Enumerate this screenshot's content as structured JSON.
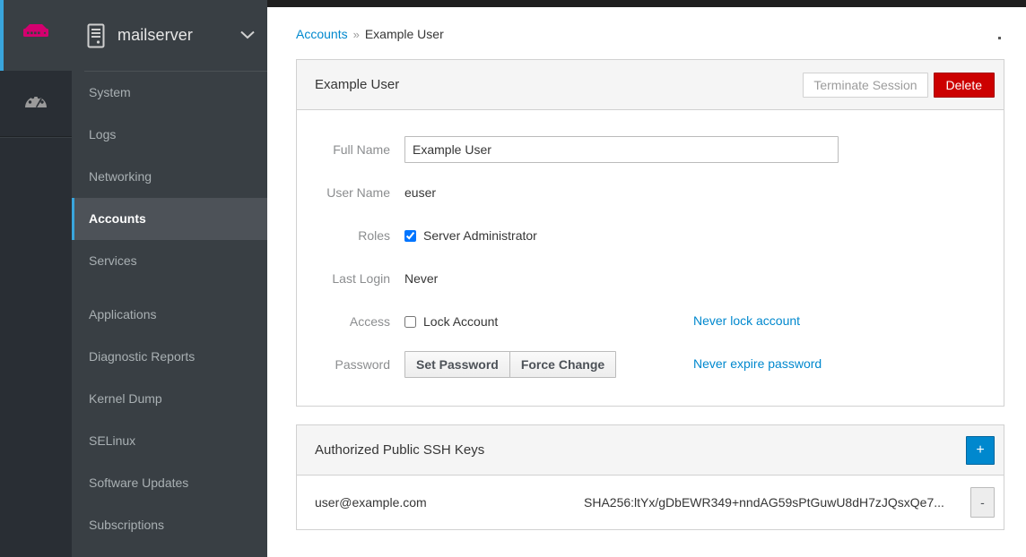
{
  "rail": {
    "brand_icon": "server-storage-icon",
    "brand_color": "#d4006f",
    "items": [
      {
        "icon": "dashboard-gauge-icon",
        "label": "Dashboard"
      }
    ]
  },
  "sidebar": {
    "host": {
      "icon": "server-tower-icon",
      "name": "mailserver",
      "caret_icon": "chevron-down-icon"
    },
    "items": [
      {
        "label": "System",
        "selected": false
      },
      {
        "label": "Logs",
        "selected": false
      },
      {
        "label": "Networking",
        "selected": false
      },
      {
        "label": "Accounts",
        "selected": true
      },
      {
        "label": "Services",
        "selected": false
      },
      {
        "label": "Applications",
        "selected": false
      },
      {
        "label": "Diagnostic Reports",
        "selected": false
      },
      {
        "label": "Kernel Dump",
        "selected": false
      },
      {
        "label": "SELinux",
        "selected": false
      },
      {
        "label": "Software Updates",
        "selected": false
      },
      {
        "label": "Subscriptions",
        "selected": false
      }
    ]
  },
  "breadcrumb": {
    "root": "Accounts",
    "separator": "»",
    "current": "Example User"
  },
  "account_panel": {
    "title": "Example User",
    "terminate_session_label": "Terminate Session",
    "delete_label": "Delete",
    "fields": {
      "full_name": {
        "label": "Full Name",
        "value": "Example User",
        "placeholder": ""
      },
      "user_name": {
        "label": "User Name",
        "value": "euser"
      },
      "roles": {
        "label": "Roles",
        "option_label": "Server Administrator",
        "checked": true
      },
      "last_login": {
        "label": "Last Login",
        "value": "Never"
      },
      "access": {
        "label": "Access",
        "lock_label": "Lock Account",
        "checked": false,
        "status_link": "Never lock account"
      },
      "password": {
        "label": "Password",
        "set_password_label": "Set Password",
        "force_change_label": "Force Change",
        "status_link": "Never expire password"
      }
    }
  },
  "ssh_panel": {
    "title": "Authorized Public SSH Keys",
    "add_label": "+",
    "remove_label": "-",
    "rows": [
      {
        "name": "user@example.com",
        "fingerprint": "SHA256:ltYx/gDbEWR349+nndAG59sPtGuwU8dH7zJQsxQe7..."
      }
    ]
  },
  "colors": {
    "accent_blue": "#0088ce",
    "rail_blue": "#39a5dc",
    "danger_red": "#cc0000",
    "brand_magenta": "#d4006f",
    "sidebar_bg": "#393f44",
    "sidebar_selected_bg": "#4d5258"
  }
}
